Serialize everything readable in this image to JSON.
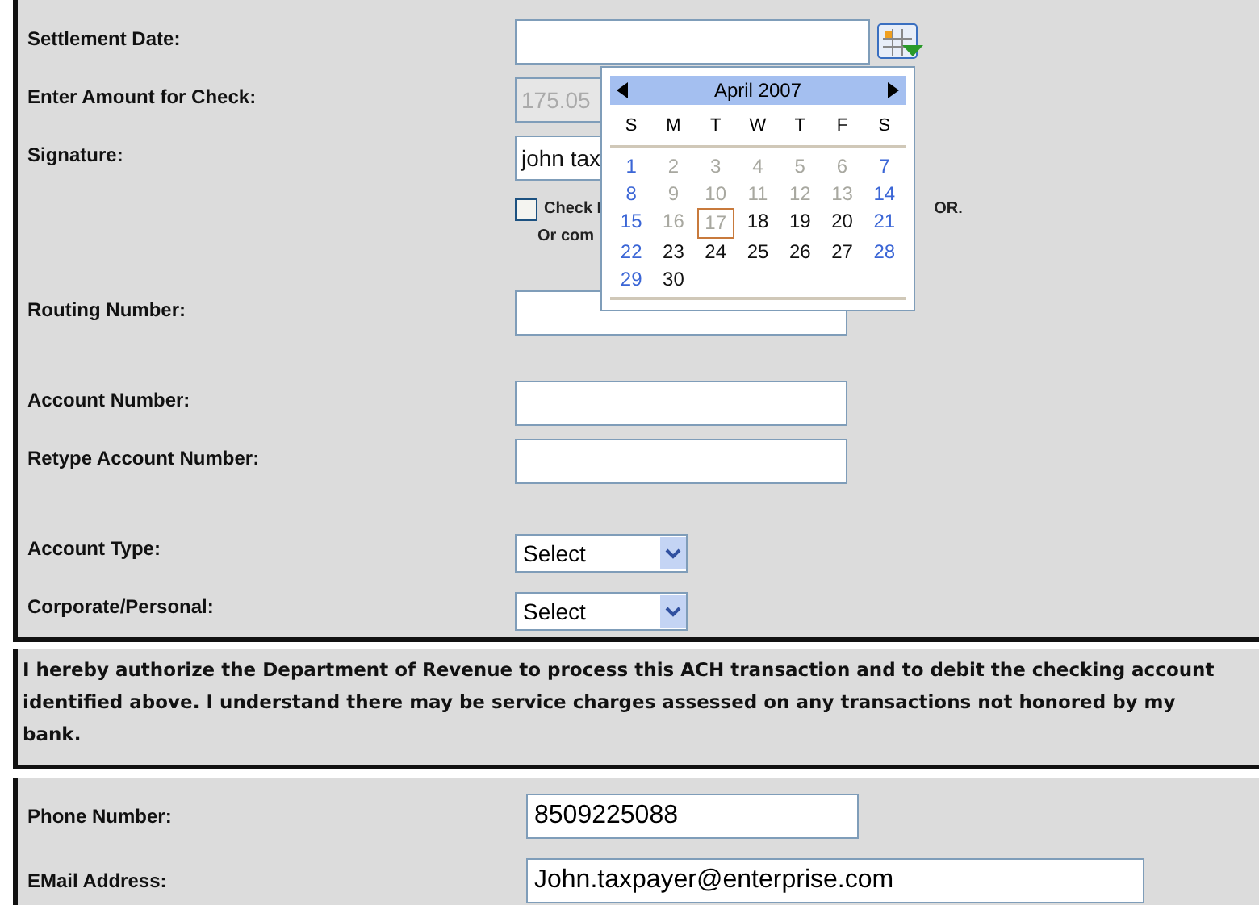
{
  "form": {
    "rows": [
      {
        "kind": "date",
        "label": "Settlement Date:",
        "value": ""
      },
      {
        "kind": "text",
        "label": "Enter Amount for Check:",
        "value": "175.05",
        "disabled": true
      },
      {
        "kind": "text",
        "label": "Signature:",
        "value": "john tax",
        "disabled": false
      },
      {
        "kind": "check",
        "checked": false,
        "label": "Check I",
        "trail": "OR.",
        "note": "Or com"
      },
      {
        "kind": "text",
        "label": "Routing Number:",
        "value": "",
        "disabled": false
      },
      {
        "kind": "spacer"
      },
      {
        "kind": "text",
        "label": "Account Number:",
        "value": "",
        "disabled": false
      },
      {
        "kind": "text",
        "label": "Retype Account Number:",
        "value": "",
        "disabled": false
      },
      {
        "kind": "spacer"
      },
      {
        "kind": "select",
        "label": "Account Type:",
        "value": "Select"
      },
      {
        "kind": "select",
        "label": "Corporate/Personal:",
        "value": "Select"
      }
    ]
  },
  "authorization": "I hereby authorize the Department of Revenue to process this ACH transaction and to debit the checking account identified above. I understand there may be service charges assessed on any transactions not honored by my bank.",
  "contact": [
    {
      "label": "Phone Number:",
      "value": "8509225088"
    },
    {
      "label": "EMail Address:",
      "value": "John.taxpayer@enterprise.com"
    }
  ],
  "calendar": {
    "month": "April 2007",
    "weekdays": [
      "S",
      "M",
      "T",
      "W",
      "T",
      "F",
      "S"
    ],
    "days": [
      {
        "day": "1",
        "kind": "weekend"
      },
      {
        "day": "2",
        "kind": "past"
      },
      {
        "day": "3",
        "kind": "past"
      },
      {
        "day": "4",
        "kind": "past"
      },
      {
        "day": "5",
        "kind": "past"
      },
      {
        "day": "6",
        "kind": "past"
      },
      {
        "day": "7",
        "kind": "weekend"
      },
      {
        "day": "8",
        "kind": "weekend"
      },
      {
        "day": "9",
        "kind": "past"
      },
      {
        "day": "10",
        "kind": "past"
      },
      {
        "day": "11",
        "kind": "past"
      },
      {
        "day": "12",
        "kind": "past"
      },
      {
        "day": "13",
        "kind": "past"
      },
      {
        "day": "14",
        "kind": "weekend"
      },
      {
        "day": "15",
        "kind": "weekend"
      },
      {
        "day": "16",
        "kind": "past"
      },
      {
        "day": "17",
        "kind": "today"
      },
      {
        "day": "18",
        "kind": "normal"
      },
      {
        "day": "19",
        "kind": "normal"
      },
      {
        "day": "20",
        "kind": "normal"
      },
      {
        "day": "21",
        "kind": "weekend"
      },
      {
        "day": "22",
        "kind": "weekend"
      },
      {
        "day": "23",
        "kind": "normal"
      },
      {
        "day": "24",
        "kind": "normal"
      },
      {
        "day": "25",
        "kind": "normal"
      },
      {
        "day": "26",
        "kind": "normal"
      },
      {
        "day": "27",
        "kind": "normal"
      },
      {
        "day": "28",
        "kind": "weekend"
      },
      {
        "day": "29",
        "kind": "weekend"
      },
      {
        "day": "30",
        "kind": "normal"
      }
    ]
  }
}
